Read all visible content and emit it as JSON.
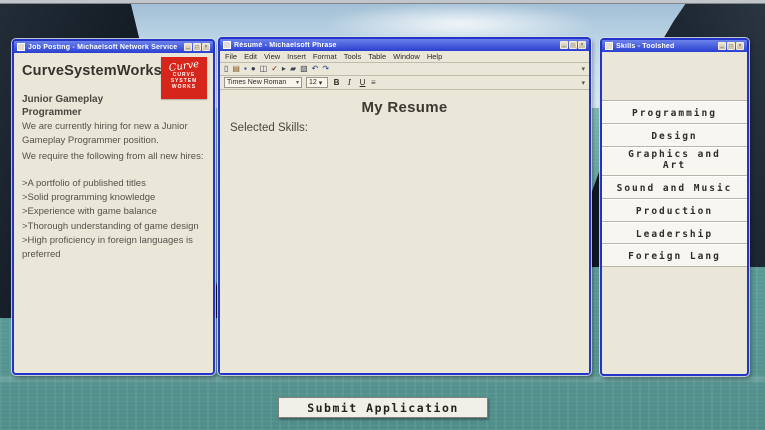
{
  "background": {
    "sky_color": "#cfe4f0",
    "water_color": "#5d9e99",
    "rock_color": "#141d27"
  },
  "window_controls": [
    {
      "name": "minimize",
      "glyph": "_"
    },
    {
      "name": "maximize",
      "glyph": "□"
    },
    {
      "name": "close",
      "glyph": "×"
    }
  ],
  "job_window": {
    "title": "Job Posting - Michaelsoft Network Service",
    "company_name": "CurveSystemWorks",
    "logo": {
      "script": "Curve",
      "lines": [
        "CURVE",
        "SYSTEM",
        "WORKS"
      ]
    },
    "position_heading": "Junior Gameplay Programmer",
    "intro_lines": [
      "We are currently hiring for new a Junior Gameplay Programmer position.",
      "We require the following from all new hires:"
    ],
    "requirements": [
      ">A portfolio of published titles",
      ">Solid programming knowledge",
      ">Experience with game balance",
      ">Thorough understanding of game design",
      ">High proficiency in foreign languages is preferred"
    ]
  },
  "resume_window": {
    "title": "Résumé - Michaelsoft Phrase",
    "menus": [
      "File",
      "Edit",
      "View",
      "Insert",
      "Format",
      "Tools",
      "Table",
      "Window",
      "Help"
    ],
    "toolbar_icons": [
      {
        "name": "new-document-icon",
        "glyph": "▯"
      },
      {
        "name": "open-icon",
        "glyph": "▤"
      },
      {
        "name": "save-icon",
        "glyph": "▪"
      },
      {
        "name": "print-icon",
        "glyph": "●"
      },
      {
        "name": "print-preview-icon",
        "glyph": "◫"
      },
      {
        "name": "spelling-check-icon",
        "glyph": "✓"
      },
      {
        "name": "cut-icon",
        "glyph": "▸"
      },
      {
        "name": "copy-icon",
        "glyph": "▰"
      },
      {
        "name": "paste-icon",
        "glyph": "▧"
      },
      {
        "name": "undo-icon",
        "glyph": "↶"
      },
      {
        "name": "redo-icon",
        "glyph": "↷"
      },
      {
        "name": "toolbar-more-icon",
        "glyph": "▾"
      }
    ],
    "font_name": "Times New Roman",
    "font_size": "12",
    "format_buttons": [
      "B",
      "I",
      "U"
    ],
    "align_icon_glyph": "≡",
    "doc_title": "My Resume",
    "skills_label": "Selected Skills:"
  },
  "skills_window": {
    "title": "Skills - Toolshed",
    "skills": [
      "Programming",
      "Design",
      "Graphics and Art",
      "Sound and Music",
      "Production",
      "Leadership",
      "Foreign Lang"
    ]
  },
  "submit": {
    "label": "Submit Application"
  }
}
